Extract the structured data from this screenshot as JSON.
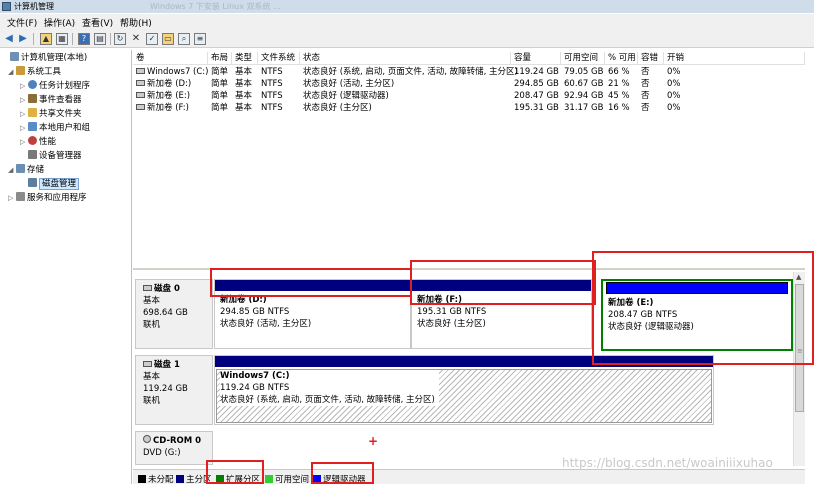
{
  "window": {
    "title": "计算机管理",
    "ghost_title": "Windows 7 下安装 Linux 双系统 ..."
  },
  "menu": {
    "items": [
      "文件(F)",
      "操作(A)",
      "查看(V)",
      "帮助(H)"
    ]
  },
  "tree": {
    "items": [
      {
        "label": "计算机管理(本地)",
        "icon": "computer-icon",
        "color": "#6f8fb5"
      },
      {
        "label": "系统工具",
        "icon": "tools-icon",
        "color": "#c89b3c"
      },
      {
        "label": "任务计划程序",
        "icon": "clock-icon",
        "color": "#4f81bd"
      },
      {
        "label": "事件查看器",
        "icon": "event-viewer-icon",
        "color": "#8b6d3a"
      },
      {
        "label": "共享文件夹",
        "icon": "shared-folder-icon",
        "color": "#e0b040"
      },
      {
        "label": "本地用户和组",
        "icon": "users-icon",
        "color": "#5b8cc7"
      },
      {
        "label": "性能",
        "icon": "performance-icon",
        "color": "#c04040"
      },
      {
        "label": "设备管理器",
        "icon": "device-manager-icon",
        "color": "#7a7a7a"
      },
      {
        "label": "存储",
        "icon": "storage-icon",
        "color": "#6a8fb0"
      },
      {
        "label": "磁盘管理",
        "icon": "disk-management-icon",
        "color": "#5f7f9f"
      },
      {
        "label": "服务和应用程序",
        "icon": "services-icon",
        "color": "#8a8a8a"
      }
    ]
  },
  "table": {
    "headers": [
      "卷",
      "布局",
      "类型",
      "文件系统",
      "状态",
      "容量",
      "可用空间",
      "% 可用",
      "容错",
      "开销"
    ],
    "rows": [
      [
        "Windows7 (C:)",
        "简单",
        "基本",
        "NTFS",
        "状态良好 (系统, 启动, 页面文件, 活动, 故障转储, 主分区)",
        "119.24 GB",
        "79.05 GB",
        "66 %",
        "否",
        "0%"
      ],
      [
        "新加卷 (D:)",
        "简单",
        "基本",
        "NTFS",
        "状态良好 (活动, 主分区)",
        "294.85 GB",
        "60.67 GB",
        "21 %",
        "否",
        "0%"
      ],
      [
        "新加卷 (E:)",
        "简单",
        "基本",
        "NTFS",
        "状态良好 (逻辑驱动器)",
        "208.47 GB",
        "92.94 GB",
        "45 %",
        "否",
        "0%"
      ],
      [
        "新加卷 (F:)",
        "简单",
        "基本",
        "NTFS",
        "状态良好 (主分区)",
        "195.31 GB",
        "31.17 GB",
        "16 %",
        "否",
        "0%"
      ]
    ]
  },
  "disks": {
    "disk0": {
      "name": "磁盘 0",
      "type": "基本",
      "size": "698.64 GB",
      "status": "联机",
      "partitions": [
        {
          "name": "新加卷  (D:)",
          "size": "294.85 GB NTFS",
          "status": "状态良好 (活动, 主分区)"
        },
        {
          "name": "新加卷  (F:)",
          "size": "195.31 GB NTFS",
          "status": "状态良好 (主分区)"
        },
        {
          "name": "新加卷  (E:)",
          "size": "208.47 GB NTFS",
          "status": "状态良好 (逻辑驱动器)"
        }
      ]
    },
    "disk1": {
      "name": "磁盘 1",
      "type": "基本",
      "size": "119.24 GB",
      "status": "联机",
      "partitions": [
        {
          "name": "Windows7  (C:)",
          "size": "119.24 GB NTFS",
          "status": "状态良好 (系统, 启动, 页面文件, 活动, 故障转储, 主分区)"
        }
      ]
    },
    "cdrom0": {
      "name": "CD-ROM 0",
      "drive": "DVD (G:)"
    }
  },
  "legend": [
    {
      "label": "未分配",
      "color": "#000000"
    },
    {
      "label": "主分区",
      "color": "#00007f"
    },
    {
      "label": "扩展分区",
      "color": "#007f00"
    },
    {
      "label": "可用空间",
      "color": "#33cc33"
    },
    {
      "label": "逻辑驱动器",
      "color": "#0000ff"
    }
  ],
  "colors": {
    "primary_band": "#00007f",
    "logical_band": "#0000ff",
    "extended_border": "#007f00",
    "highlight": "#e02020"
  },
  "watermark": "https://blog.csdn.net/woainiiixuhao",
  "annotation_plus": "+"
}
